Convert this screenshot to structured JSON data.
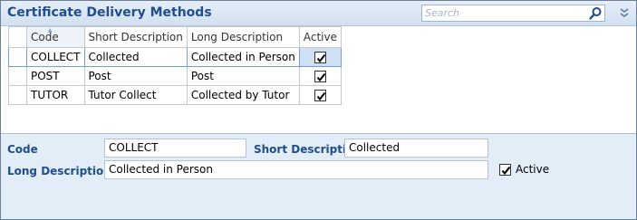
{
  "header": {
    "title": "Certificate Delivery Methods",
    "search_placeholder": "Search"
  },
  "grid": {
    "columns": [
      "Code",
      "Short Description",
      "Long Description",
      "Active"
    ],
    "rows": [
      {
        "code": "COLLECT",
        "short": "Collected",
        "long": "Collected in Person",
        "active": true
      },
      {
        "code": "POST",
        "short": "Post",
        "long": "Post",
        "active": true
      },
      {
        "code": "TUTOR",
        "short": "Tutor Collect",
        "long": "Collected by Tutor",
        "active": true
      }
    ]
  },
  "form": {
    "code_label": "Code",
    "code_value": "COLLECT",
    "short_label": "Short Description",
    "short_value": "Collected",
    "long_label": "Long Description",
    "long_value": "Collected in Person",
    "active_label": "Active",
    "active_checked": true
  },
  "icons": {
    "search": "search-icon",
    "collapse": "double-chevron-down-icon",
    "sort": "sort-ascending-icon",
    "splitter": "splitter-grip-icon"
  },
  "colors": {
    "title": "#1f4e8c",
    "form_bg": "#e3edf8",
    "selection": "#cfe0f5"
  }
}
